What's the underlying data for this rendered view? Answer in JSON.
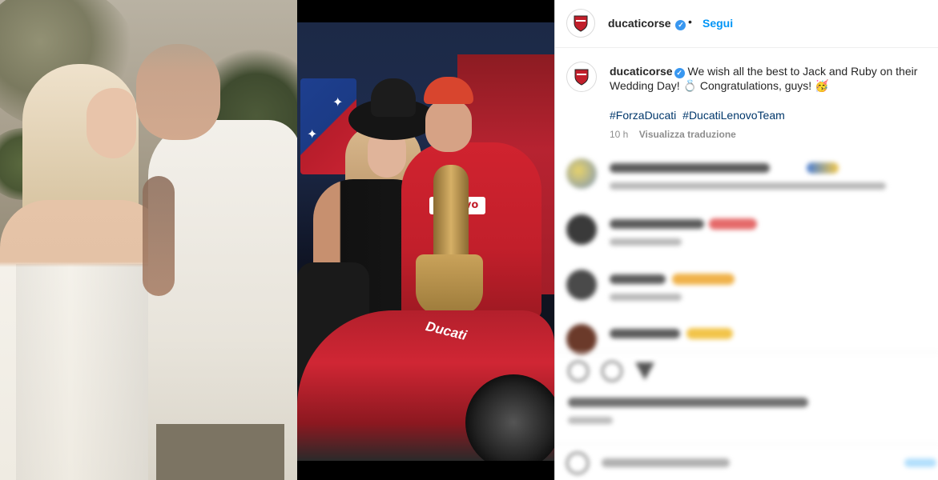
{
  "post": {
    "username": "ducaticorse",
    "verified_mark": "✓",
    "follow_label": "Segui",
    "dot": "•",
    "caption_username": "ducaticorse",
    "caption_text": " We wish all the best to Jack and Ruby on their Wedding Day! 💍 Congratulations, guys! 🥳",
    "hashtags": [
      "#ForzaDucati",
      "#DucatiLenovoTeam"
    ],
    "time_ago": "10 h",
    "translate_label": "Visualizza traduzione"
  },
  "middle_photo": {
    "sponsor": "Lenovo",
    "bike_logo": "Ducati",
    "flag_star": "✦"
  },
  "icons": {
    "avatar": "ducati-shield-icon",
    "verified": "verified-badge-icon",
    "like": "heart-icon",
    "comment": "comment-icon",
    "share": "share-icon",
    "emoji": "emoji-icon"
  },
  "colors": {
    "link": "#0095f6",
    "hashtag": "#00376b",
    "muted": "#8e8e8e",
    "ducati_red": "#c21f2b"
  }
}
